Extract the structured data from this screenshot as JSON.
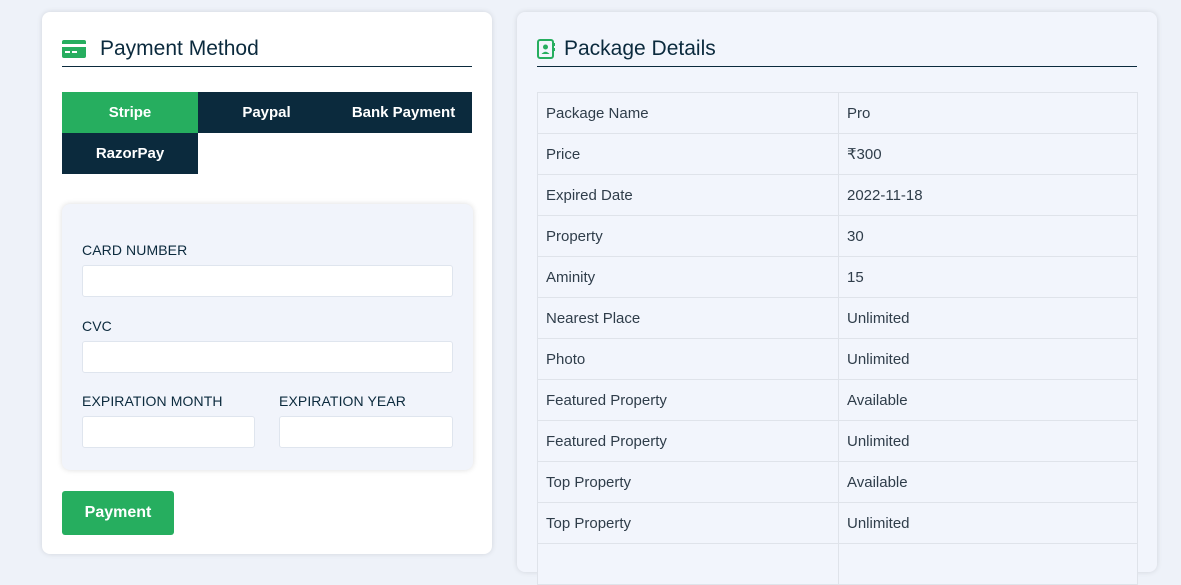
{
  "payment": {
    "title": "Payment Method",
    "tabs": [
      {
        "label": "Stripe",
        "active": true
      },
      {
        "label": "Paypal",
        "active": false
      },
      {
        "label": "Bank Payment",
        "active": false
      },
      {
        "label": "RazorPay",
        "active": false
      }
    ],
    "form": {
      "card_number_label": "CARD NUMBER",
      "cvc_label": "CVC",
      "exp_month_label": "EXPIRATION MONTH",
      "exp_year_label": "EXPIRATION YEAR",
      "card_number_value": "",
      "cvc_value": "",
      "exp_month_value": "",
      "exp_year_value": ""
    },
    "submit_label": "Payment"
  },
  "package": {
    "title": "Package Details",
    "rows": [
      {
        "key": "Package Name",
        "value": "Pro"
      },
      {
        "key": "Price",
        "value": "₹300"
      },
      {
        "key": "Expired Date",
        "value": "2022-11-18"
      },
      {
        "key": "Property",
        "value": "30"
      },
      {
        "key": "Aminity",
        "value": "15"
      },
      {
        "key": "Nearest Place",
        "value": "Unlimited"
      },
      {
        "key": "Photo",
        "value": "Unlimited"
      },
      {
        "key": "Featured Property",
        "value": "Available"
      },
      {
        "key": "Featured Property",
        "value": "Unlimited"
      },
      {
        "key": "Top Property",
        "value": "Available"
      },
      {
        "key": "Top Property",
        "value": "Unlimited"
      },
      {
        "key": "",
        "value": ""
      }
    ]
  },
  "colors": {
    "accent": "#26ae5f",
    "dark": "#0b2a3d",
    "background": "#eef2f9"
  },
  "icons": {
    "payment": "credit-card-icon",
    "package": "contact-book-icon"
  }
}
